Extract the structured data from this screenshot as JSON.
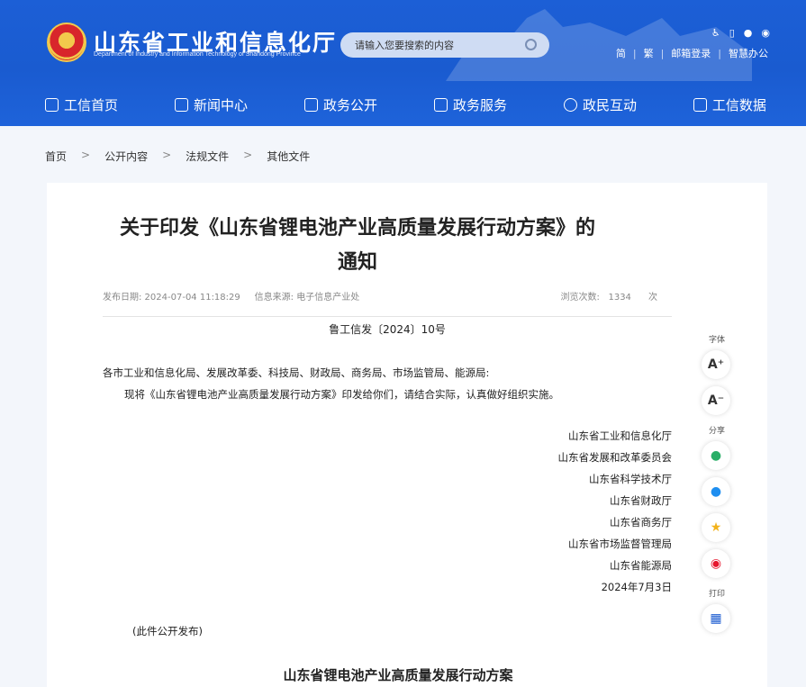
{
  "header": {
    "site_title": "山东省工业和信息化厅",
    "site_subtitle": "Department of Industry and Information Technology of Shandong Province",
    "search_placeholder": "请输入您要搜索的内容",
    "lang_simple": "简",
    "lang_traditional": "繁",
    "mail_login": "邮箱登录",
    "smart_office": "智慧办公"
  },
  "nav": [
    {
      "label": "工信首页"
    },
    {
      "label": "新闻中心"
    },
    {
      "label": "政务公开"
    },
    {
      "label": "政务服务"
    },
    {
      "label": "政民互动"
    },
    {
      "label": "工信数据"
    }
  ],
  "breadcrumb": [
    "首页",
    "公开内容",
    "法规文件",
    "其他文件"
  ],
  "article": {
    "title_line1": "关于印发《山东省锂电池产业高质量发展行动方案》的",
    "title_line2": "通知",
    "publish_date": "发布日期: 2024-07-04 11:18:29",
    "source": "信息来源: 电子信息产业处",
    "views_label": "浏览次数:",
    "views_count": "1334",
    "views_unit": "次",
    "doc_number": "鲁工信发〔2024〕10号",
    "recipients": "各市工业和信息化局、发展改革委、科技局、财政局、商务局、市场监管局、能源局:",
    "body": "现将《山东省锂电池产业高质量发展行动方案》印发给你们，请结合实际，认真做好组织实施。",
    "signatures": [
      "山东省工业和信息化厅",
      "山东省发展和改革委员会",
      "山东省科学技术厅",
      "山东省财政厅",
      "山东省商务厅",
      "山东省市场监督管理局",
      "山东省能源局",
      "2024年7月3日"
    ],
    "note": "(此件公开发布)",
    "subtitle": "山东省锂电池产业高质量发展行动方案"
  },
  "side": {
    "font_label": "字体",
    "font_up": "A⁺",
    "font_down": "A⁻",
    "share_label": "分享",
    "print_label": "打印"
  }
}
